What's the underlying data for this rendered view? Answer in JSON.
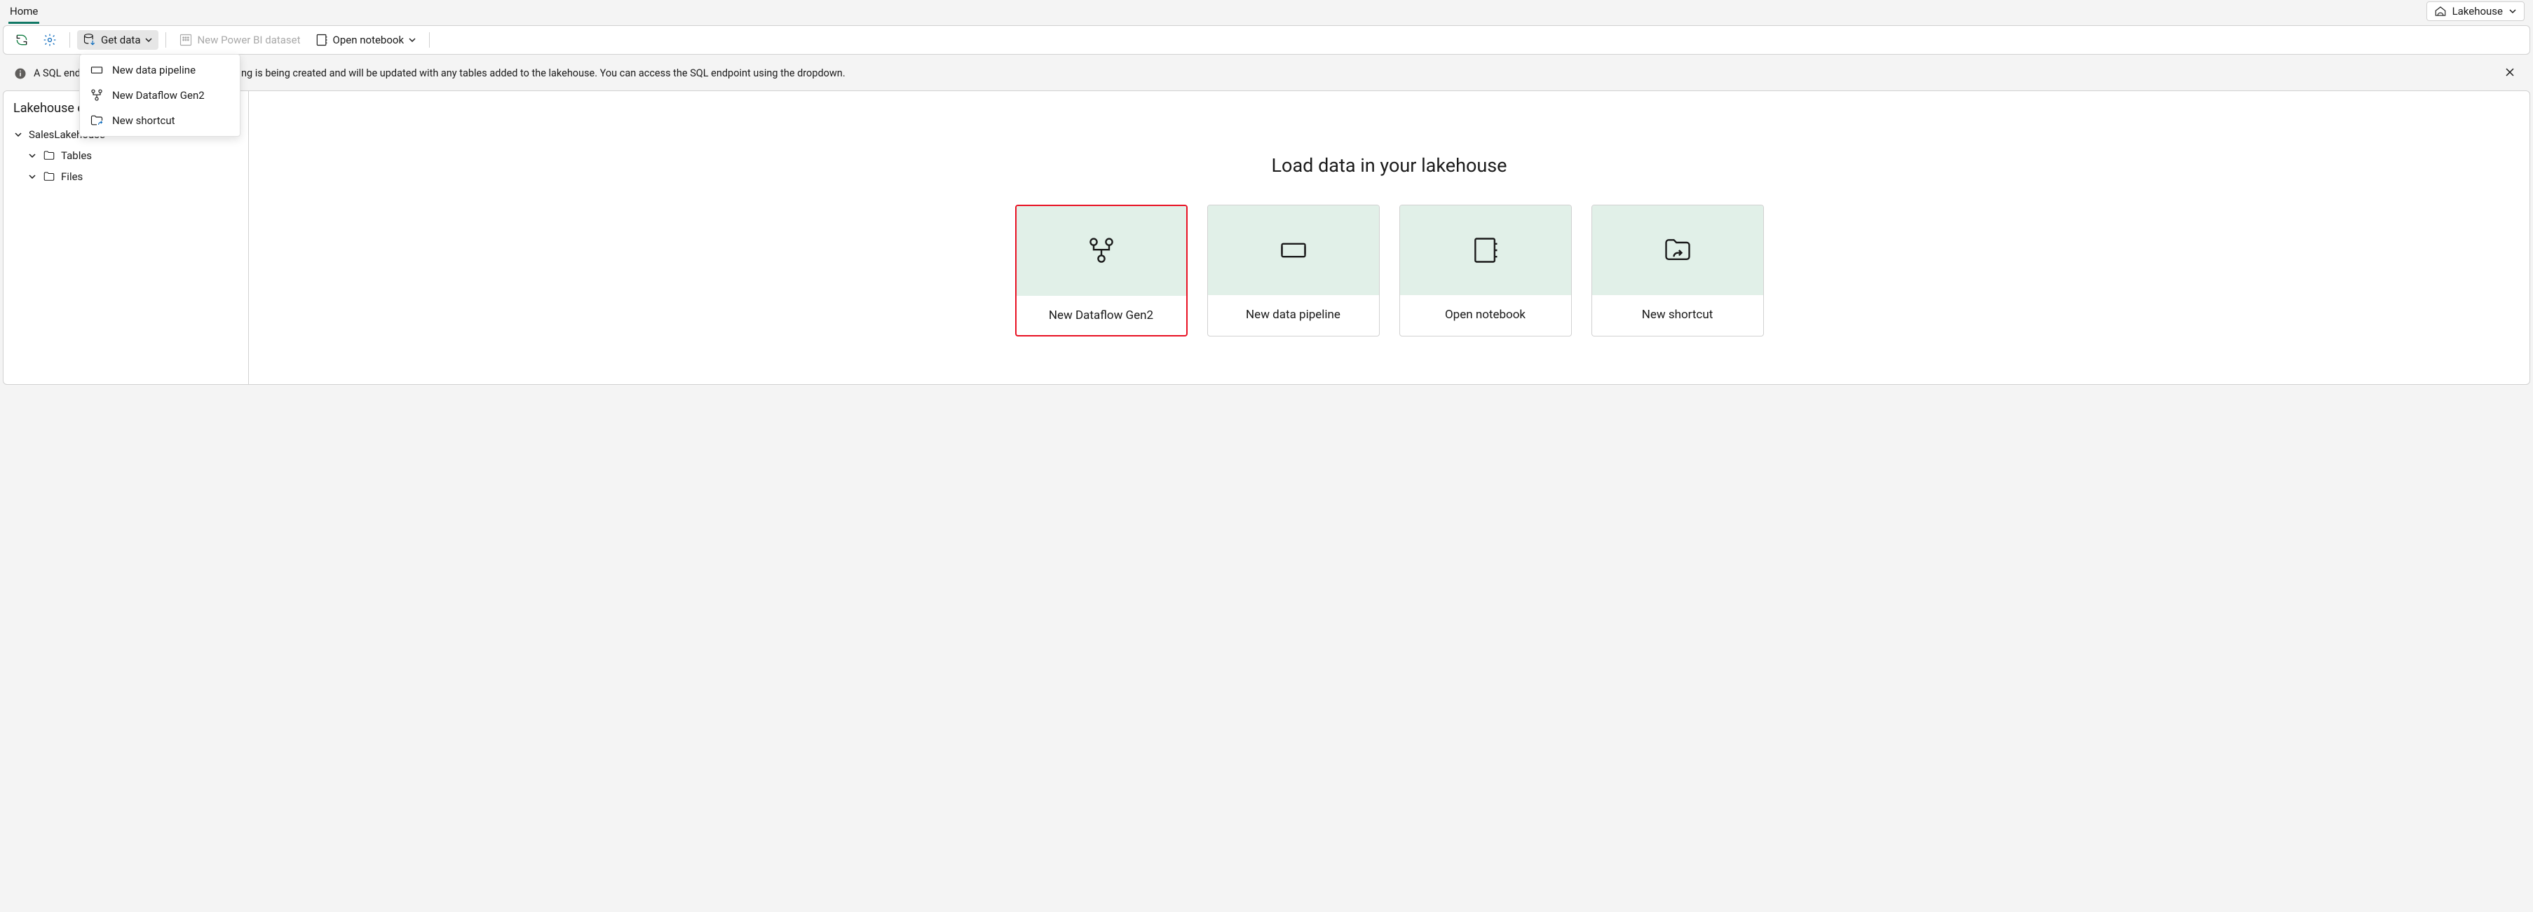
{
  "header": {
    "tab_home": "Home",
    "view_switch": "Lakehouse"
  },
  "toolbar": {
    "get_data": "Get data",
    "new_pbi_dataset": "New Power BI dataset",
    "open_notebook": "Open notebook"
  },
  "get_data_menu": {
    "new_pipeline": "New data pipeline",
    "new_dataflow": "New Dataflow Gen2",
    "new_shortcut": "New shortcut"
  },
  "notification": {
    "text": "A SQL endpoint and default dataset for reporting is being created and will be updated with any tables added to the lakehouse. You can access the SQL endpoint using the dropdown."
  },
  "explorer": {
    "title": "Lakehouse explorer",
    "root": "SalesLakehouse",
    "tables": "Tables",
    "files": "Files"
  },
  "content": {
    "title": "Load data in your lakehouse",
    "cards": {
      "dataflow": "New Dataflow Gen2",
      "pipeline": "New data pipeline",
      "notebook": "Open notebook",
      "shortcut": "New shortcut"
    }
  }
}
